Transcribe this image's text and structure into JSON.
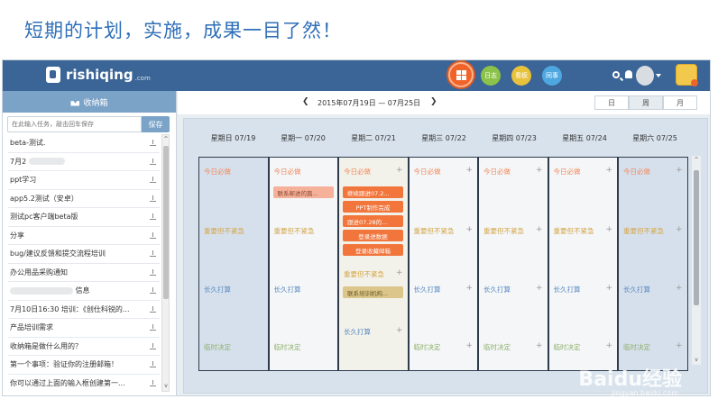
{
  "caption": "短期的计划，实施，成果一目了然！",
  "topbar": {
    "logo_text": "rishiqing",
    "logo_suffix": ".com",
    "nav": [
      {
        "label": "",
        "icon": "grid-icon",
        "color": "#f0642a"
      },
      {
        "label": "日志",
        "icon": "journal-icon",
        "color": "#8bc34a"
      },
      {
        "label": "看板",
        "icon": "board-icon",
        "color": "#e9c23c"
      },
      {
        "label": "同事",
        "icon": "colleague-icon",
        "color": "#4fa7e0"
      }
    ]
  },
  "sidebar": {
    "header": "收纳箱",
    "input_placeholder": "在此输入任务，敲击回车保存",
    "save_label": "保存",
    "items": [
      "beta-测试.",
      "7月2",
      "ppt学习",
      "app5.2测试（安卓）",
      "测试pc客户端beta版",
      "分享",
      "bug/建议反馈和提交流程培训",
      "办公用品采购通知",
      "信息",
      "7月10日16:30 培训：《创仕科锐的...",
      "产品培训需求",
      "收纳箱是做什么用的？",
      "第一个事项：验证你的注册邮箱！",
      "你可以通过上面的输入框创建第一..."
    ]
  },
  "datebar": {
    "range": "2015年07月19日 — 07月25日",
    "views": [
      "日",
      "周",
      "月"
    ],
    "active_view": "周"
  },
  "days": [
    {
      "title": "星期日 07/19"
    },
    {
      "title": "星期一 07/20"
    },
    {
      "title": "星期二 07/21"
    },
    {
      "title": "星期三 07/22"
    },
    {
      "title": "星期四 07/23"
    },
    {
      "title": "星期五 07/24"
    },
    {
      "title": "星期六 07/25"
    }
  ],
  "quadrants": {
    "today": "今日必做",
    "important": "重要但不紧急",
    "longterm": "长久打算",
    "adhoc": "临时决定"
  },
  "tasks": {
    "mon": [
      "联系邮进的篇..."
    ],
    "tue_today": [
      "继续跟进07.2...",
      "PPT制作完成",
      "跟进07.28的...",
      "登录进数据",
      "登录收藏邮箱"
    ],
    "tue_important": [
      "联系培训机构..."
    ]
  },
  "watermark": {
    "text": "Baidu经验",
    "sub": "jingyan.baidu.com"
  }
}
